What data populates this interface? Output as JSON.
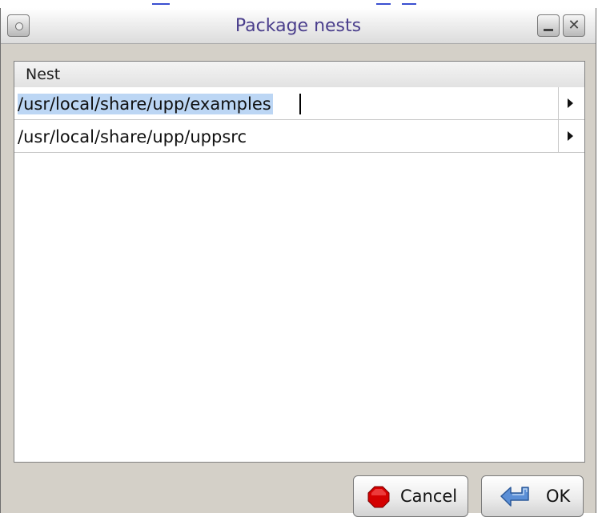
{
  "window": {
    "title": "Package nests"
  },
  "list": {
    "column_header": "Nest",
    "rows": [
      {
        "path": "/usr/local/share/upp/examples",
        "selected": true
      },
      {
        "path": "/usr/local/share/upp/uppsrc",
        "selected": false
      }
    ]
  },
  "buttons": {
    "cancel_label": "Cancel",
    "ok_label": "OK"
  },
  "colors": {
    "title_text": "#4a3e8c",
    "selection": "#bcd6f4",
    "cancel_icon": "#d40000",
    "ok_icon": "#5b8fd6"
  },
  "icons": {
    "window_menu": "circle-dot-icon",
    "minimize": "minimize-icon",
    "close": "close-icon",
    "row_expand": "triangle-right-icon",
    "cancel": "stop-sign-icon",
    "ok": "return-arrow-icon"
  }
}
